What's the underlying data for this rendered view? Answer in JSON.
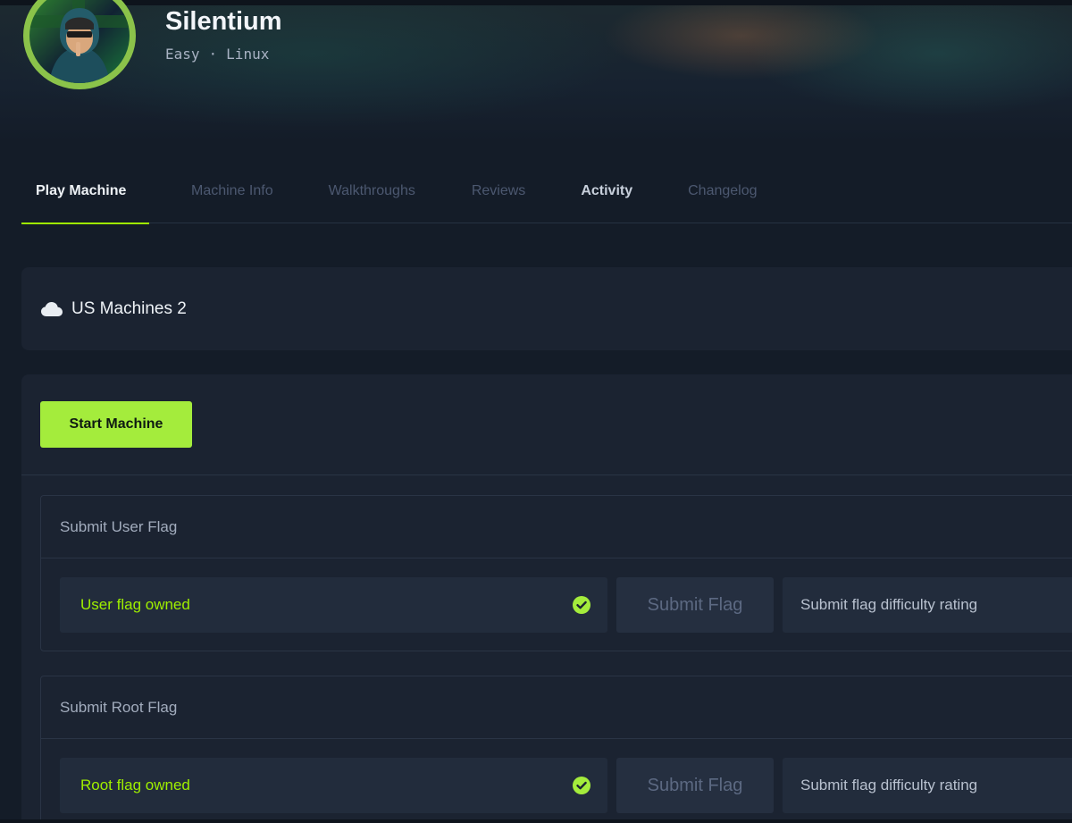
{
  "machine": {
    "name": "Silentium",
    "difficulty": "Easy",
    "separator": "·",
    "os": "Linux"
  },
  "tabs": [
    {
      "label": "Play Machine",
      "state": "active"
    },
    {
      "label": "Machine Info",
      "state": "dim"
    },
    {
      "label": "Walkthroughs",
      "state": "dim"
    },
    {
      "label": "Reviews",
      "state": "dim"
    },
    {
      "label": "Activity",
      "state": "bright"
    },
    {
      "label": "Changelog",
      "state": "dim"
    }
  ],
  "server": {
    "icon": "cloud-icon",
    "label": "US Machines 2"
  },
  "actions": {
    "start_label": "Start Machine"
  },
  "user_flag": {
    "title": "Submit User Flag",
    "status": "User flag owned",
    "submit_label": "Submit Flag",
    "rating_label": "Submit flag difficulty rating"
  },
  "root_flag": {
    "title": "Submit Root Flag",
    "status": "Root flag owned",
    "submit_label": "Submit Flag",
    "rating_label": "Submit flag difficulty rating"
  },
  "colors": {
    "accent": "#9fef00",
    "button": "#a4ec3c",
    "background": "#141c28",
    "panel": "#1b2331"
  }
}
